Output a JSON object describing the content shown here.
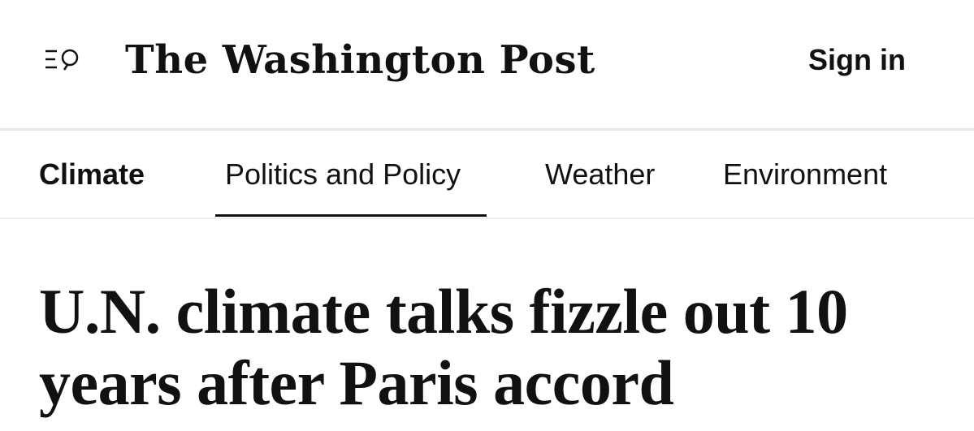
{
  "header": {
    "menu_icon": "menu-search-icon",
    "masthead": "The Washington Post",
    "sign_in": "Sign in"
  },
  "subnav": {
    "items": [
      {
        "label": "Climate",
        "active": false,
        "section": true
      },
      {
        "label": "Politics and Policy",
        "active": true,
        "section": false
      },
      {
        "label": "Weather",
        "active": false,
        "section": false
      },
      {
        "label": "Environment",
        "active": false,
        "section": false
      }
    ]
  },
  "article": {
    "headline": "U.N. climate talks fizzle out 10 years after Paris accord"
  },
  "colors": {
    "text": "#111111",
    "divider": "#e8e8e8",
    "background": "#ffffff"
  }
}
